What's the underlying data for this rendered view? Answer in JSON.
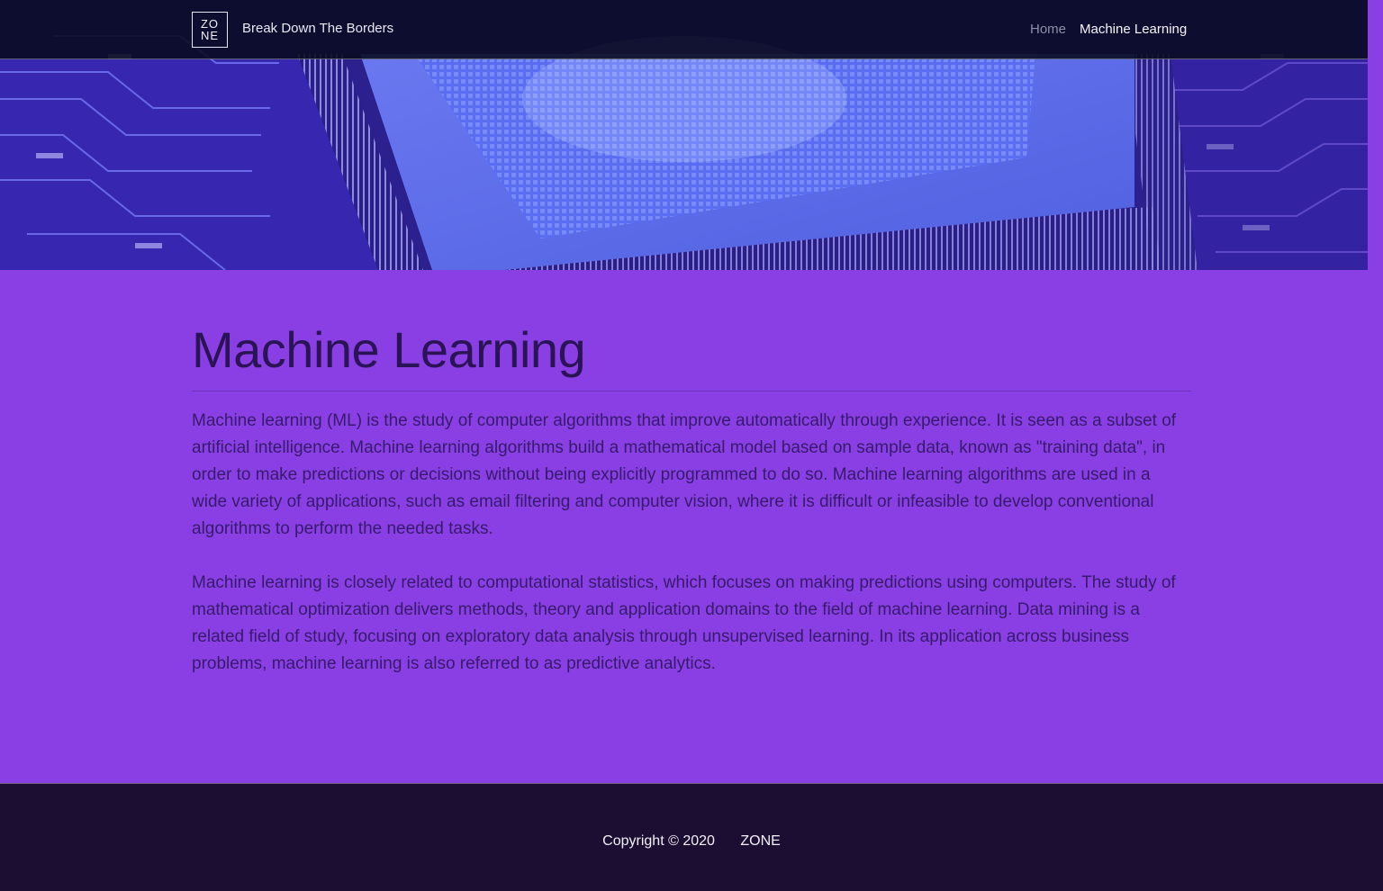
{
  "navbar": {
    "logo_top": "ZO",
    "logo_bottom": "NE",
    "brand": "Break Down The Borders",
    "links": [
      {
        "label": "Home"
      },
      {
        "label": "Machine Learning"
      }
    ]
  },
  "hero": {
    "image": "circuit-board-chip-image"
  },
  "main": {
    "title": "Machine Learning",
    "paragraphs": [
      "Machine learning (ML) is the study of computer algorithms that improve automatically through experience. It is seen as a subset of artificial intelligence. Machine learning algorithms build a mathematical model based on sample data, known as \"training data\", in order to make predictions or decisions without being explicitly programmed to do so. Machine learning algorithms are used in a wide variety of applications, such as email filtering and computer vision, where it is difficult or infeasible to develop conventional algorithms to perform the needed tasks.",
      "Machine learning is closely related to computational statistics, which focuses on making predictions using computers. The study of mathematical optimization delivers methods, theory and application domains to the field of machine learning. Data mining is a related field of study, focusing on exploratory data analysis through unsupervised learning. In its application across business problems, machine learning is also referred to as predictive analytics."
    ]
  },
  "footer": {
    "copyright": "Copyright © 2020",
    "brand": "ZONE"
  },
  "colors": {
    "page_background": "#8a3fe4",
    "navbar_background": "#080a1e",
    "footer_background": "#1c0e32",
    "title_text": "#2a1456",
    "body_text": "#361a6c"
  }
}
